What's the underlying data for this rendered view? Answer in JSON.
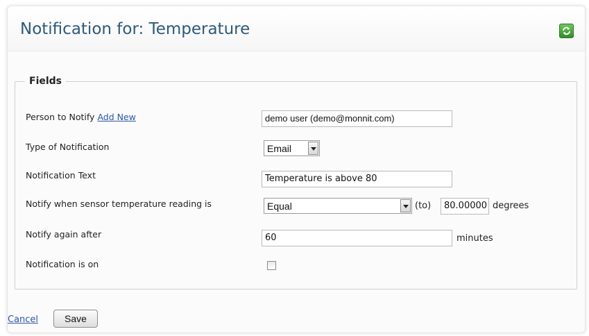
{
  "header": {
    "title": "Notification for: Temperature",
    "refresh_icon": "refresh-icon"
  },
  "fieldset": {
    "legend": "Fields"
  },
  "person": {
    "label": "Person to Notify",
    "add_new": "Add New",
    "value": "demo user (demo@monnit.com)"
  },
  "type": {
    "label": "Type of Notification",
    "selected": "Email"
  },
  "text": {
    "label": "Notification Text",
    "value": "Temperature is above 80"
  },
  "condition": {
    "label": "Notify when sensor temperature reading is",
    "selected": "Equal",
    "to_label": "(to)",
    "threshold": "80.00000",
    "unit": "degrees"
  },
  "again": {
    "label": "Notify again after",
    "value": "60",
    "unit": "minutes"
  },
  "is_on": {
    "label": "Notification is on",
    "checked": false
  },
  "actions": {
    "cancel": "Cancel",
    "save": "Save"
  },
  "colors": {
    "title": "#2e5a7a",
    "link": "#2a55a8",
    "refresh_green": "#3a9a33"
  }
}
